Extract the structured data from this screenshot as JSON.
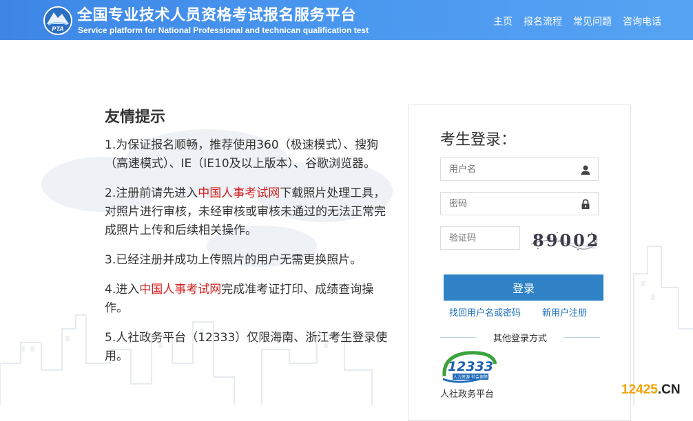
{
  "header": {
    "logo_text": "PTA",
    "title": "全国专业技术人员资格考试报名服务平台",
    "subtitle": "Service platform for National Professional and technican qualification test",
    "nav": [
      {
        "label": "主页"
      },
      {
        "label": "报名流程"
      },
      {
        "label": "常见问题"
      },
      {
        "label": "咨询电话"
      }
    ]
  },
  "tips": {
    "title": "友情提示",
    "items": [
      {
        "text": "1.为保证报名顺畅，推荐使用360（极速模式）、搜狗（高速模式）、IE（IE10及以上版本）、谷歌浏览器。"
      },
      {
        "before": "2.注册前请先进入",
        "link": "中国人事考试网",
        "after": "下载照片处理工具，对照片进行审核，未经审核或审核未通过的无法正常完成照片上传和后续相关操作。"
      },
      {
        "text": "3.已经注册并成功上传照片的用户无需更换照片。"
      },
      {
        "before": "4.进入",
        "link": "中国人事考试网",
        "after": "完成准考证打印、成绩查询操作。"
      },
      {
        "text": "5.人社政务平台（12333）仅限海南、浙江考生登录使用。"
      }
    ]
  },
  "login": {
    "title": "考生登录：",
    "username_placeholder": "用户名",
    "password_placeholder": "密码",
    "captcha_placeholder": "验证码",
    "captcha_text": "89002",
    "submit_label": "登录",
    "recover_link": "找回用户名或密码",
    "register_link": "新用户注册",
    "other_login": "其他登录方式",
    "rs_logo_number": "12333",
    "rs_logo_slogan": "人力资源 社会保障",
    "rs_label": "人社政务平台"
  },
  "watermark": {
    "main": "12425",
    "suffix": ".CN"
  },
  "colors": {
    "header": "#4a97ef",
    "button": "#2f82c6",
    "link": "#1c6fc0",
    "highlight": "#d21f1f"
  }
}
